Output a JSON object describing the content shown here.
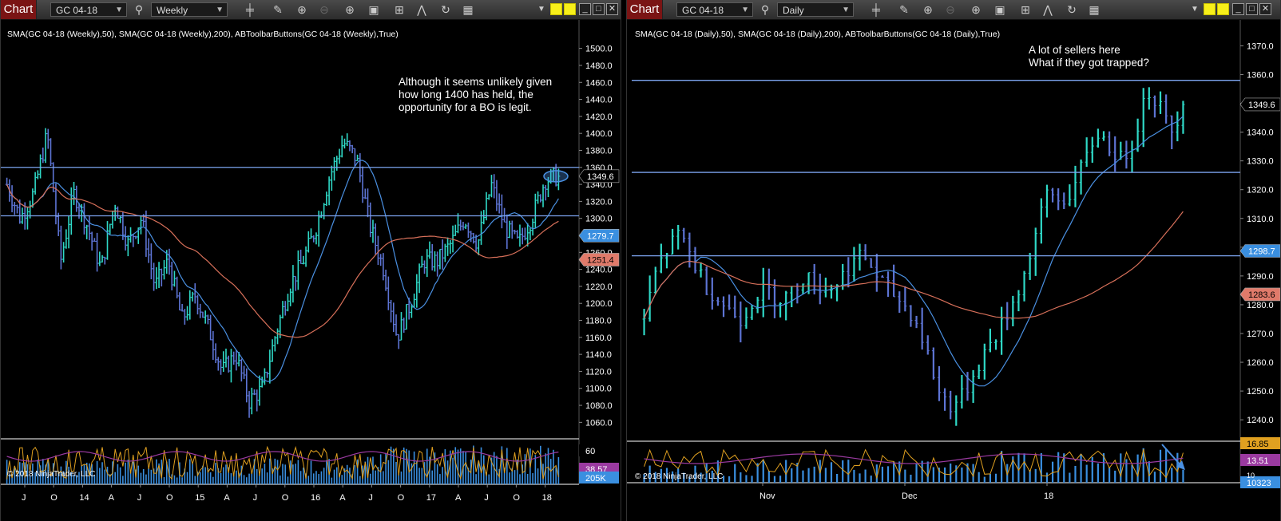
{
  "colors": {
    "bull": "#2fd9c7",
    "bear": "#5d74d4",
    "sma50": "#4a90e2",
    "sma200": "#d8705a",
    "hline": "#7da4f0",
    "text": "#ffffff",
    "volume": "#3a8fe0"
  },
  "left": {
    "chart_button": "Chart",
    "instrument": "GC 04-18",
    "period": "Weekly",
    "indicators": "SMA(GC 04-18 (Weekly),50), SMA(GC 04-18 (Weekly),200), ABToolbarButtons(GC 04-18 (Weekly),True)",
    "note": [
      "Although it seems unlikely given",
      "how long 1400 has held, the",
      "opportunity for a BO is legit."
    ],
    "copyright": "© 2018 NinjaTrader, LLC",
    "price_labels": {
      "last": "1349.6",
      "sma50": "1279.7",
      "sma200": "1251.4"
    },
    "vol_labels": {
      "a": "60",
      "b": "38.57",
      "c": "205K"
    },
    "x_ticks": [
      "J",
      "O",
      "14",
      "A",
      "J",
      "O",
      "15",
      "A",
      "J",
      "O",
      "16",
      "A",
      "J",
      "O",
      "17",
      "A",
      "J",
      "O",
      "18"
    ]
  },
  "right": {
    "chart_button": "Chart",
    "instrument": "GC 04-18",
    "period": "Daily",
    "indicators": "SMA(GC 04-18 (Daily),50), SMA(GC 04-18 (Daily),200), ABToolbarButtons(GC 04-18 (Daily),True)",
    "note": [
      "A lot of sellers here",
      "What if they got trapped?"
    ],
    "copyright": "© 2018 NinjaTrader, LLC",
    "price_labels": {
      "last": "1349.6",
      "sma50": "1298.7",
      "sma200": "1283.6"
    },
    "vol_labels": {
      "a": "16.85",
      "b": "13.51",
      "c": "10323",
      "d": "10"
    },
    "x_ticks": [
      "Nov",
      "Dec",
      "18"
    ]
  },
  "chart_data": [
    {
      "type": "candlestick",
      "title": "GC 04-18 Weekly",
      "ylim": [
        1050,
        1510
      ],
      "y_ticks": [
        "1500.0",
        "1480.0",
        "1460.0",
        "1440.0",
        "1420.0",
        "1400.0",
        "1380.0",
        "1360.0",
        "1340.0",
        "1320.0",
        "1300.0",
        "1280.0",
        "1260.0",
        "1240.0",
        "1220.0",
        "1200.0",
        "1180.0",
        "1160.0",
        "1140.0",
        "1120.0",
        "1100.0",
        "1080.0",
        "1060.0"
      ],
      "horizontal_lines": [
        1360,
        1303
      ],
      "close_path": [
        1340,
        1300,
        1330,
        1400,
        1250,
        1330,
        1290,
        1240,
        1320,
        1270,
        1300,
        1220,
        1250,
        1180,
        1210,
        1170,
        1120,
        1140,
        1085,
        1100,
        1165,
        1220,
        1250,
        1290,
        1350,
        1390,
        1370,
        1290,
        1240,
        1160,
        1200,
        1250,
        1250,
        1270,
        1300,
        1270,
        1340,
        1290,
        1270,
        1300,
        1345,
        1349.6
      ]
    },
    {
      "type": "candlestick",
      "title": "GC 04-18 Daily",
      "ylim": [
        1232,
        1374
      ],
      "y_ticks": [
        "1370.0",
        "1360.0",
        "1350.0",
        "1340.0",
        "1330.0",
        "1320.0",
        "1310.0",
        "1300.0",
        "1290.0",
        "1280.0",
        "1270.0",
        "1260.0",
        "1250.0",
        "1240.0"
      ],
      "horizontal_lines": [
        1358,
        1326,
        1297
      ],
      "close_path": [
        1275,
        1292,
        1300,
        1305,
        1295,
        1287,
        1282,
        1278,
        1275,
        1283,
        1285,
        1282,
        1284,
        1290,
        1287,
        1285,
        1289,
        1295,
        1297,
        1290,
        1285,
        1281,
        1276,
        1265,
        1250,
        1245,
        1248,
        1257,
        1265,
        1271,
        1280,
        1290,
        1305,
        1320,
        1315,
        1320,
        1330,
        1340,
        1335,
        1330,
        1338,
        1355,
        1350,
        1340,
        1349.6
      ]
    }
  ]
}
